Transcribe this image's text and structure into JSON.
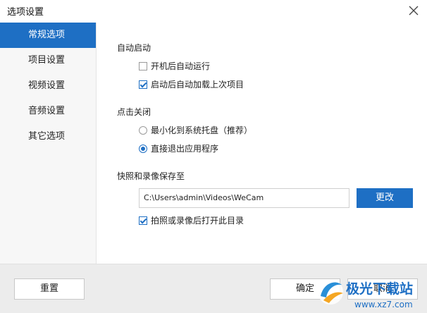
{
  "window": {
    "title": "选项设置"
  },
  "sidebar": {
    "items": [
      {
        "label": "常规选项",
        "active": true
      },
      {
        "label": "项目设置"
      },
      {
        "label": "视频设置"
      },
      {
        "label": "音频设置"
      },
      {
        "label": "其它选项"
      }
    ]
  },
  "content": {
    "autostart": {
      "title": "自动启动",
      "options": [
        {
          "label": "开机后自动运行",
          "checked": false
        },
        {
          "label": "启动后自动加载上次项目",
          "checked": true
        }
      ]
    },
    "close_action": {
      "title": "点击关闭",
      "options": [
        {
          "label": "最小化到系统托盘（推荐）",
          "selected": false
        },
        {
          "label": "直接退出应用程序",
          "selected": true
        }
      ]
    },
    "save_to": {
      "title": "快照和录像保存至",
      "path": "C:\\Users\\admin\\Videos\\WeCam",
      "change_label": "更改",
      "open_after": {
        "label": "拍照或录像后打开此目录",
        "checked": true
      }
    }
  },
  "footer": {
    "reset_label": "重置",
    "ok_label": "确定",
    "cancel_label": "取消"
  },
  "watermark": {
    "name": "极光下载站",
    "url": "www.xz7.com"
  },
  "colors": {
    "accent": "#1e6fc4",
    "sidebar_bg": "#f7f7f7",
    "footer_bg": "#ececec"
  }
}
